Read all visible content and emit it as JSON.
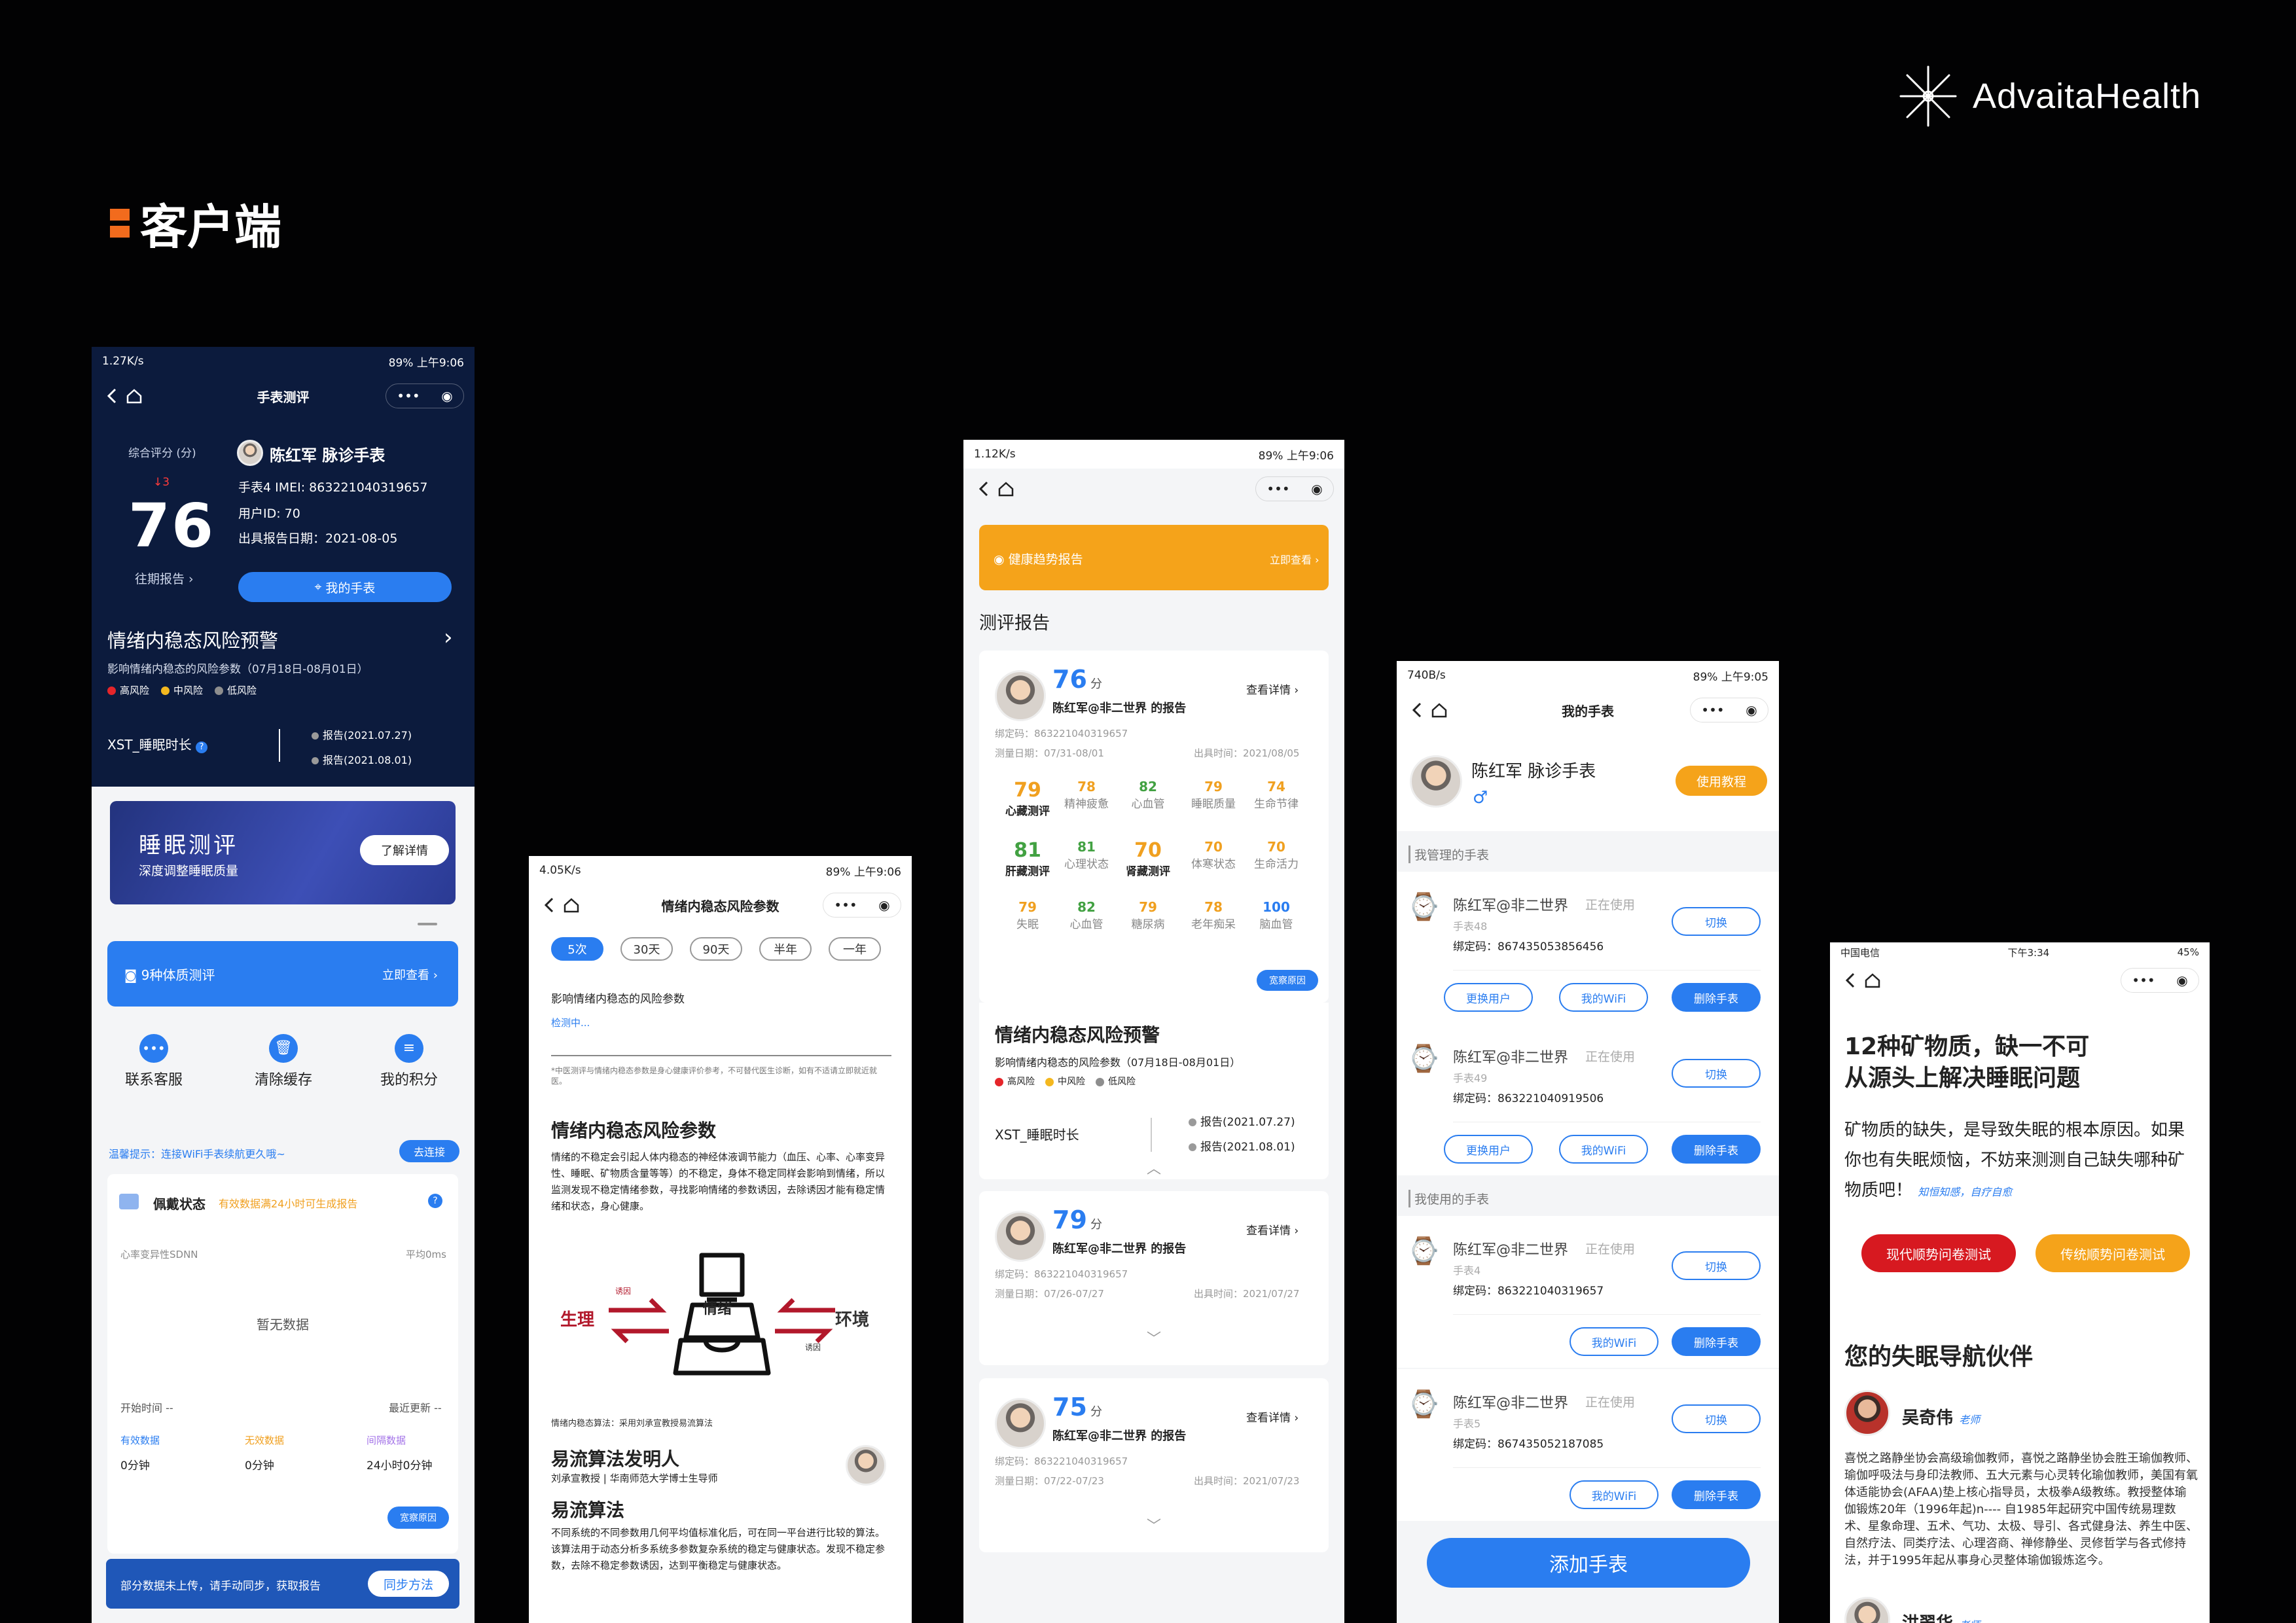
{
  "slide": {
    "logo_text": "AdvaitaHealth",
    "section_title": "客户端"
  },
  "p1": {
    "status": {
      "left": "1.27K/s",
      "right": "89%  上午9:06"
    },
    "nav_title": "手表测评",
    "score_label": "综合评分 (分)",
    "score_delta": "3",
    "score": "76",
    "history": "往期报告",
    "user": "陈红军 脉诊手表",
    "imei": "手表4 IMEI: 863221040319657",
    "uid": "用户ID: 70",
    "date": "出具报告日期：2021-08-05",
    "my_watch": "我的手表",
    "warn_title": "情绪内稳态风险预警",
    "warn_sub": "影响情绪内稳态的风险参数（07月18日-08月01日）",
    "legend": [
      "高风险",
      "中风险",
      "低风险"
    ],
    "xst": "XST_睡眠时长",
    "report1": "报告(2021.07.27)",
    "report2": "报告(2021.08.01)",
    "banner_title": "睡眠测评",
    "banner_sub": "深度调整睡眠质量",
    "banner_btn": "了解详情",
    "constitution": "9种体质测评",
    "constitution_go": "立即查看",
    "actions": [
      "联系客服",
      "清除缓存",
      "我的积分"
    ],
    "tip": "温馨提示：连接WiFi手表续航更久哦~",
    "tip_btn": "去连接",
    "wear": "佩戴状态",
    "wear_note": "有效数据满24小时可生成报告",
    "hrv": "心率变异性SDNN",
    "avg": "平均0ms",
    "no_data": "暂无数据",
    "start": "开始时间 --",
    "update": "最近更新 --",
    "stats": [
      {
        "label": "有效数据",
        "value": "0分钟"
      },
      {
        "label": "无效数据",
        "value": "0分钟"
      },
      {
        "label": "间隔数据",
        "value": "24小时0分钟"
      }
    ],
    "reason": "宽察原因",
    "sync_text": "部分数据未上传，请手动同步，获取报告",
    "sync_btn": "同步方法"
  },
  "p2": {
    "status": {
      "left": "4.05K/s",
      "right": "89%  上午9:06"
    },
    "nav_title": "情绪内稳态风险参数",
    "tabs": [
      "5次",
      "30天",
      "90天",
      "半年",
      "一年"
    ],
    "param_title": "影响情绪内稳态的风险参数",
    "detecting": "检测中...",
    "disclaimer": "*中医测评与情绪内稳态参数是身心健康评价参考，不可替代医生诊断，如有不适请立即就近就医。",
    "section": "情绪内稳态风险参数",
    "body": "情绪的不稳定会引起人体内稳态的神经体液调节能力（血压、心率、心率变异性、睡眠、矿物质含量等等）的不稳定，身体不稳定同样会影响到情绪，所以监测发现不稳定情绪参数，寻找影响情绪的参数诱因，去除诱因才能有稳定情绪和状态，身心健康。",
    "fig_left": "生理",
    "fig_right": "环境",
    "fig_center": "情绪",
    "fig_cause1": "诱因",
    "fig_cause2": "诱因",
    "algo_note": "情绪内稳态算法：采用刘承宣教授易流算法",
    "inventor_title": "易流算法发明人",
    "inventor_desc": "刘承宣教授 | 华南师范大学博士生导师",
    "algo_title": "易流算法",
    "algo_body": "不同系统的不同参数用几何平均值标准化后，可在同一平台进行比较的算法。该算法用于动态分析多系统多参数复杂系统的稳定与健康状态。发现不稳定参数，去除不稳定参数诱因，达到平衡稳定与健康状态。"
  },
  "p3": {
    "status": {
      "left": "1.12K/s",
      "right": "89%  上午9:06"
    },
    "trend": "健康趋势报告",
    "trend_go": "立即查看",
    "section": "测评报告",
    "r1": {
      "score": "76",
      "unit": "分",
      "name": "陈红军@非二世界 的报告",
      "detail": "查看详情",
      "bind": "绑定码：863221040319657",
      "measure": "测量日期：07/31-08/01",
      "issue": "出具时间：2021/08/05"
    },
    "metrics": [
      {
        "v": "79",
        "l": "心藏测评",
        "c": "#f0a020",
        "main": true
      },
      {
        "v": "78",
        "l": "精神疲惫",
        "c": "#f0a020"
      },
      {
        "v": "82",
        "l": "心血管",
        "c": "#42a142"
      },
      {
        "v": "79",
        "l": "睡眠质量",
        "c": "#f0a020"
      },
      {
        "v": "74",
        "l": "生命节律",
        "c": "#f0a020"
      },
      {
        "v": "81",
        "l": "肝藏测评",
        "c": "#42a142",
        "main": true
      },
      {
        "v": "81",
        "l": "心理状态",
        "c": "#42a142"
      },
      {
        "v": "70",
        "l": "肾藏测评",
        "c": "#f0a020",
        "main": true
      },
      {
        "v": "70",
        "l": "体寒状态",
        "c": "#f0a020"
      },
      {
        "v": "70",
        "l": "生命活力",
        "c": "#f0a020"
      },
      {
        "v": "79",
        "l": "失眠",
        "c": "#f0a020"
      },
      {
        "v": "82",
        "l": "心血管",
        "c": "#42a142"
      },
      {
        "v": "79",
        "l": "糖尿病",
        "c": "#f0a020"
      },
      {
        "v": "78",
        "l": "老年痴呆",
        "c": "#f0a020"
      },
      {
        "v": "100",
        "l": "脑血管",
        "c": "#2a7df0"
      }
    ],
    "reason": "宽察原因",
    "warn_title": "情绪内稳态风险预警",
    "warn_sub": "影响情绪内稳态的风险参数（07月18日-08月01日）",
    "legend": [
      "高风险",
      "中风险",
      "低风险"
    ],
    "xst": "XST_睡眠时长",
    "report1": "报告(2021.07.27)",
    "report2": "报告(2021.08.01)",
    "r2": {
      "score": "79",
      "unit": "分",
      "name": "陈红军@非二世界 的报告",
      "detail": "查看详情",
      "bind": "绑定码：863221040319657",
      "measure": "测量日期：07/26-07/27",
      "issue": "出具时间：2021/07/27"
    },
    "r3": {
      "score": "75",
      "unit": "分",
      "name": "陈红军@非二世界 的报告",
      "detail": "查看详情",
      "bind": "绑定码：863221040319657",
      "measure": "测量日期：07/22-07/23",
      "issue": "出具时间：2021/07/23"
    }
  },
  "p4": {
    "status": {
      "left": "740B/s",
      "right": "89%  上午9:05"
    },
    "nav_title": "我的手表",
    "user": "陈红军 脉诊手表",
    "tutorial": "使用教程",
    "managed": "我管理的手表",
    "using": "我使用的手表",
    "in_use": "正在使用",
    "switch": "切换",
    "change_user": "更换用户",
    "wifi": "我的WiFi",
    "delete": "删除手表",
    "w1": {
      "name": "陈红军@非二世界",
      "model": "手表48",
      "code": "绑定码：867435053856456"
    },
    "w2": {
      "name": "陈红军@非二世界",
      "model": "手表49",
      "code": "绑定码：863221040919506"
    },
    "w3": {
      "name": "陈红军@非二世界",
      "model": "手表4",
      "code": "绑定码：863221040319657"
    },
    "w4": {
      "name": "陈红军@非二世界",
      "model": "手表5",
      "code": "绑定码：867435052187085"
    },
    "add": "添加手表"
  },
  "p5": {
    "status": {
      "left": "中国电信",
      "center": "下午3:34",
      "right": "45%"
    },
    "headline1": "12种矿物质，缺一不可",
    "headline2": "从源头上解决睡眠问题",
    "body": "矿物质的缺失，是导致失眠的根本原因。如果你也有失眠烦恼，不妨来测测自己缺失哪种矿物质吧！",
    "sign": "知恒知感，自疗自愈",
    "btn1": "现代顺势问卷测试",
    "btn2": "传统顺势问卷测试",
    "partner_title": "您的失眠导航伙伴",
    "person1": "吴奇伟",
    "role": "老师",
    "person1_bio": "喜悦之路静坐协会高级瑜伽教师，喜悦之路静坐协会胜王瑜伽教师、瑜伽呼吸法与身印法教师、五大元素与心灵转化瑜伽教师，美国有氧体适能协会(AFAA)垫上核心指导员，太极拳A级教练。教授整体瑜伽锻炼20年（1996年起)n---- 自1985年起研究中国传统易理数术、星象命理、五术、气功、太极、导引、各式健身法、养生中医、自然疗法、同类疗法、心理咨商、禅修静坐、灵修哲学与各式修持法，并于1995年起从事身心灵整体瑜伽锻炼迄今。",
    "person2": "洪翠华"
  }
}
